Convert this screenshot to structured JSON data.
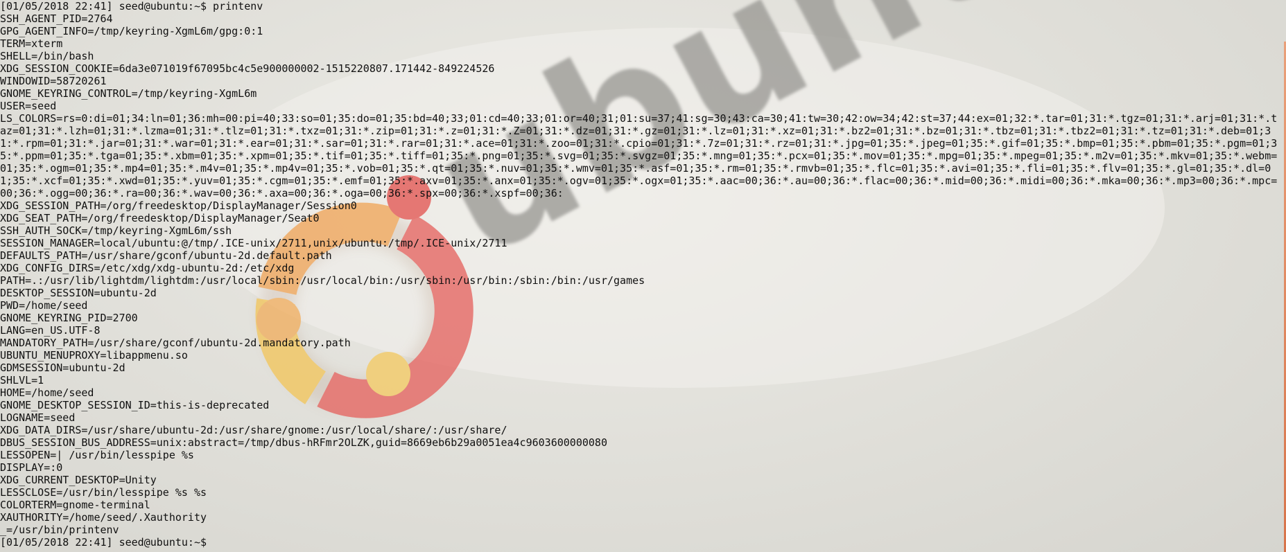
{
  "wallpaper": {
    "brand_text": "ubuntu",
    "logo_colors": [
      "#e8504b",
      "#f5a65a",
      "#f6c85a"
    ]
  },
  "terminal": {
    "lines": [
      "[01/05/2018 22:41] seed@ubuntu:~$ printenv",
      "SSH_AGENT_PID=2764",
      "GPG_AGENT_INFO=/tmp/keyring-XgmL6m/gpg:0:1",
      "TERM=xterm",
      "SHELL=/bin/bash",
      "XDG_SESSION_COOKIE=6da3e071019f67095bc4c5e900000002-1515220807.171442-849224526",
      "WINDOWID=58720261",
      "GNOME_KEYRING_CONTROL=/tmp/keyring-XgmL6m",
      "USER=seed"
    ],
    "ls_colors": "LS_COLORS=rs=0:di=01;34:ln=01;36:mh=00:pi=40;33:so=01;35:do=01;35:bd=40;33;01:cd=40;33;01:or=40;31;01:su=37;41:sg=30;43:ca=30;41:tw=30;42:ow=34;42:st=37;44:ex=01;32:*.tar=01;31:*.tgz=01;31:*.arj=01;31:*.taz=01;31:*.lzh=01;31:*.lzma=01;31:*.tlz=01;31:*.txz=01;31:*.zip=01;31:*.z=01;31:*.Z=01;31:*.dz=01;31:*.gz=01;31:*.lz=01;31:*.xz=01;31:*.bz2=01;31:*.bz=01;31:*.tbz=01;31:*.tbz2=01;31:*.tz=01;31:*.deb=01;31:*.rpm=01;31:*.jar=01;31:*.war=01;31:*.ear=01;31:*.sar=01;31:*.rar=01;31:*.ace=01;31:*.zoo=01;31:*.cpio=01;31:*.7z=01;31:*.rz=01;31:*.jpg=01;35:*.jpeg=01;35:*.gif=01;35:*.bmp=01;35:*.pbm=01;35:*.pgm=01;35:*.ppm=01;35:*.tga=01;35:*.xbm=01;35:*.xpm=01;35:*.tif=01;35:*.tiff=01;35:*.png=01;35:*.svg=01;35:*.svgz=01;35:*.mng=01;35:*.pcx=01;35:*.mov=01;35:*.mpg=01;35:*.mpeg=01;35:*.m2v=01;35:*.mkv=01;35:*.webm=01;35:*.ogm=01;35:*.mp4=01;35:*.m4v=01;35:*.mp4v=01;35:*.vob=01;35:*.qt=01;35:*.nuv=01;35:*.wmv=01;35:*.asf=01;35:*.rm=01;35:*.rmvb=01;35:*.flc=01;35:*.avi=01;35:*.fli=01;35:*.flv=01;35:*.gl=01;35:*.dl=01;35:*.xcf=01;35:*.xwd=01;35:*.yuv=01;35:*.cgm=01;35:*.emf=01;35:*.axv=01;35:*.anx=01;35:*.ogv=01;35:*.ogx=01;35:*.aac=00;36:*.au=00;36:*.flac=00;36:*.mid=00;36:*.midi=00;36:*.mka=00;36:*.mp3=00;36:*.mpc=00;36:*.ogg=00;36:*.ra=00;36:*.wav=00;36:*.axa=00;36:*.oga=00;36:*.spx=00;36:*.xspf=00;36:",
    "lines_after": [
      "XDG_SESSION_PATH=/org/freedesktop/DisplayManager/Session0",
      "XDG_SEAT_PATH=/org/freedesktop/DisplayManager/Seat0",
      "SSH_AUTH_SOCK=/tmp/keyring-XgmL6m/ssh",
      "SESSION_MANAGER=local/ubuntu:@/tmp/.ICE-unix/2711,unix/ubuntu:/tmp/.ICE-unix/2711",
      "DEFAULTS_PATH=/usr/share/gconf/ubuntu-2d.default.path",
      "XDG_CONFIG_DIRS=/etc/xdg/xdg-ubuntu-2d:/etc/xdg",
      "PATH=.:/usr/lib/lightdm/lightdm:/usr/local/sbin:/usr/local/bin:/usr/sbin:/usr/bin:/sbin:/bin:/usr/games",
      "DESKTOP_SESSION=ubuntu-2d",
      "PWD=/home/seed",
      "GNOME_KEYRING_PID=2700",
      "LANG=en_US.UTF-8",
      "MANDATORY_PATH=/usr/share/gconf/ubuntu-2d.mandatory.path",
      "UBUNTU_MENUPROXY=libappmenu.so",
      "GDMSESSION=ubuntu-2d",
      "SHLVL=1",
      "HOME=/home/seed",
      "GNOME_DESKTOP_SESSION_ID=this-is-deprecated",
      "LOGNAME=seed",
      "XDG_DATA_DIRS=/usr/share/ubuntu-2d:/usr/share/gnome:/usr/local/share/:/usr/share/",
      "DBUS_SESSION_BUS_ADDRESS=unix:abstract=/tmp/dbus-hRFmr2OLZK,guid=8669eb6b29a0051ea4c9603600000080",
      "LESSOPEN=| /usr/bin/lesspipe %s",
      "DISPLAY=:0",
      "XDG_CURRENT_DESKTOP=Unity",
      "LESSCLOSE=/usr/bin/lesspipe %s %s",
      "COLORTERM=gnome-terminal",
      "XAUTHORITY=/home/seed/.Xauthority",
      "_=/usr/bin/printenv"
    ],
    "prompt": "[01/05/2018 22:41] seed@ubuntu:~$ "
  }
}
